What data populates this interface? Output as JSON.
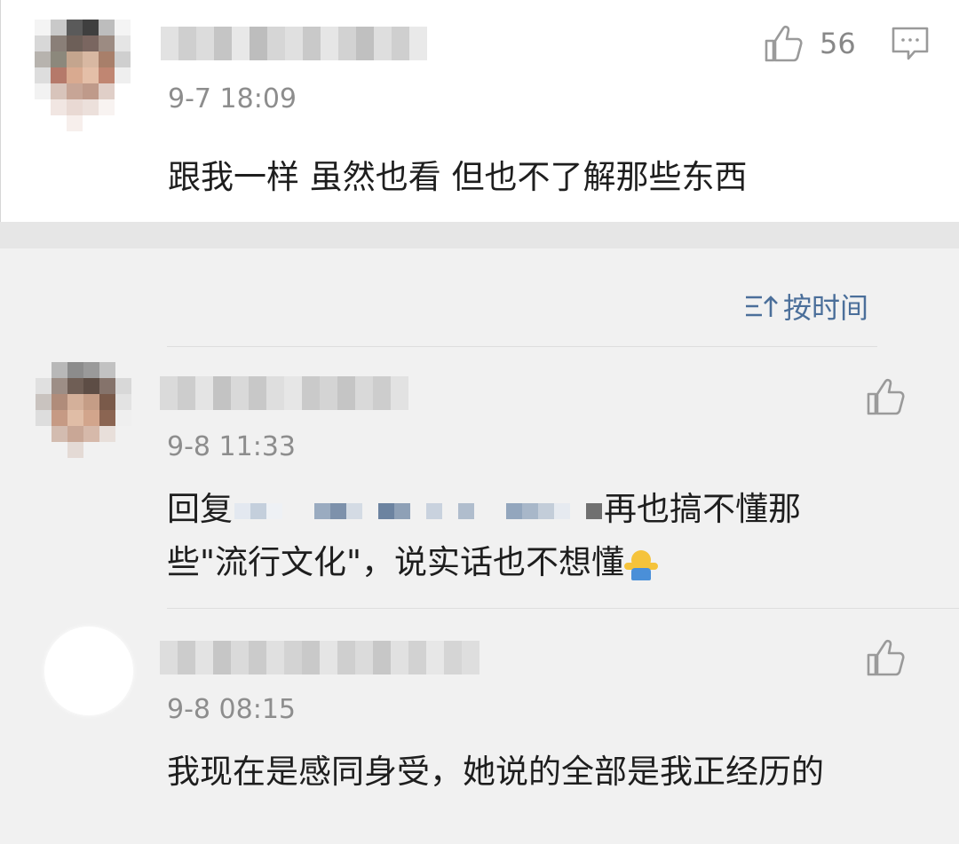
{
  "main_comment": {
    "timestamp": "9-7 18:09",
    "like_count": "56",
    "text": "跟我一样 虽然也看 但也不了解那些东西"
  },
  "sort": {
    "label": "按时间"
  },
  "replies": [
    {
      "timestamp": "9-8 11:33",
      "text_prefix": "回复",
      "text_line1_tail": "再也搞不懂那",
      "text_line2": "些\"流行文化\"，说实话也不想懂"
    },
    {
      "timestamp": "9-8 08:15",
      "text": "我现在是感同身受，她说的全部是我正经历的"
    }
  ],
  "colors": {
    "accent": "#4b6f9a",
    "timestamp": "#8d8d8d",
    "icon": "#9a9a9a"
  },
  "icons": {
    "like": "thumbs-up-icon",
    "reply": "comment-bubble-icon",
    "sort": "sort-time-icon",
    "emoji": "hug-emoji-icon"
  }
}
